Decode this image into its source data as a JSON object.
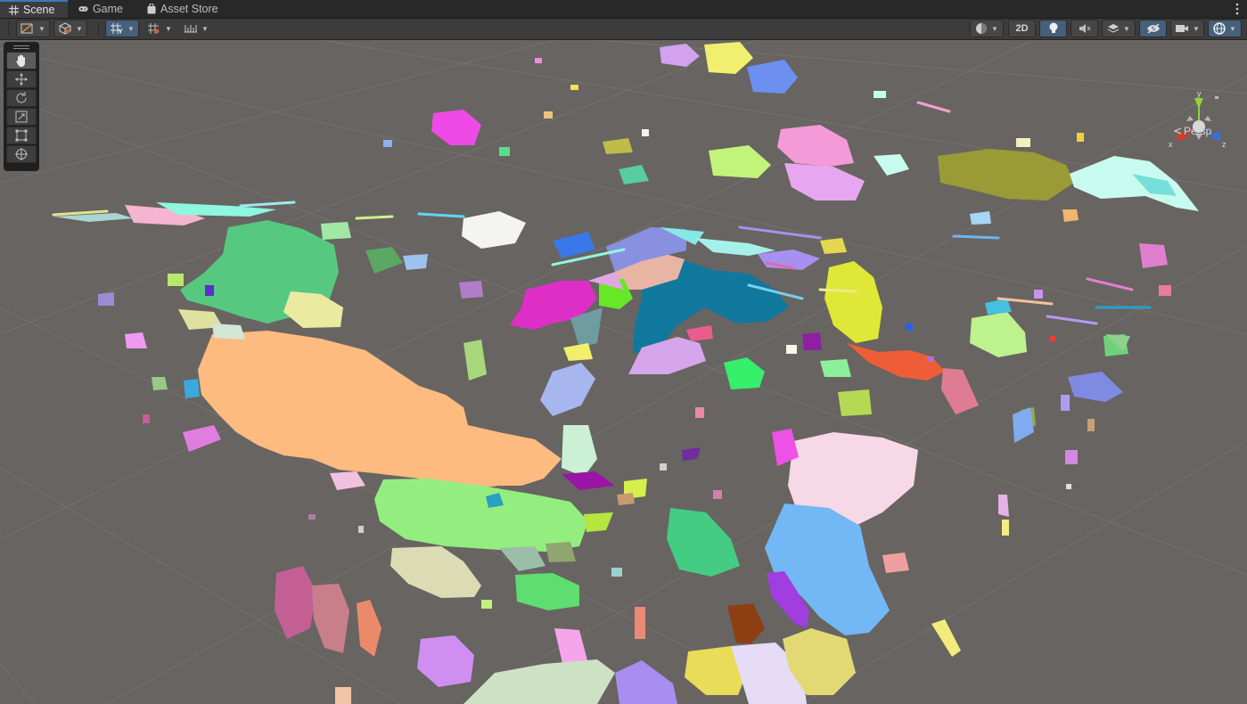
{
  "tabs": [
    {
      "label": "Scene",
      "icon": "grid-icon",
      "active": true
    },
    {
      "label": "Game",
      "icon": "gamepad-icon",
      "active": false
    },
    {
      "label": "Asset Store",
      "icon": "shopping-bag-icon",
      "active": false
    }
  ],
  "toolbar": {
    "left": [
      "draw-mode-dropdown",
      "cube-view-dropdown",
      "grid-snap-dropdown",
      "grid-visibility-dropdown",
      "increment-snap-dropdown"
    ],
    "toggle_2d_label": "2D",
    "right": [
      "shading-mode-dropdown",
      "2d-toggle",
      "lighting-toggle",
      "audio-toggle",
      "effects-dropdown",
      "scene-visibility-toggle",
      "camera-dropdown",
      "gizmos-dropdown"
    ]
  },
  "tools": [
    "hand-tool",
    "move-tool",
    "rotate-tool",
    "scale-tool",
    "rect-tool",
    "transform-tool"
  ],
  "gizmo": {
    "axis_labels": {
      "y": "y",
      "x": "x",
      "z": "z"
    },
    "projection_label": "Persp"
  },
  "colors": {
    "viewport_bg": "#686461",
    "toolbar_bg": "#3c3c3c",
    "tab_bg": "#282828",
    "active_accent": "#46607c",
    "x_axis": "#d6392c",
    "y_axis": "#8ed63a",
    "z_axis": "#3a6fd6"
  }
}
